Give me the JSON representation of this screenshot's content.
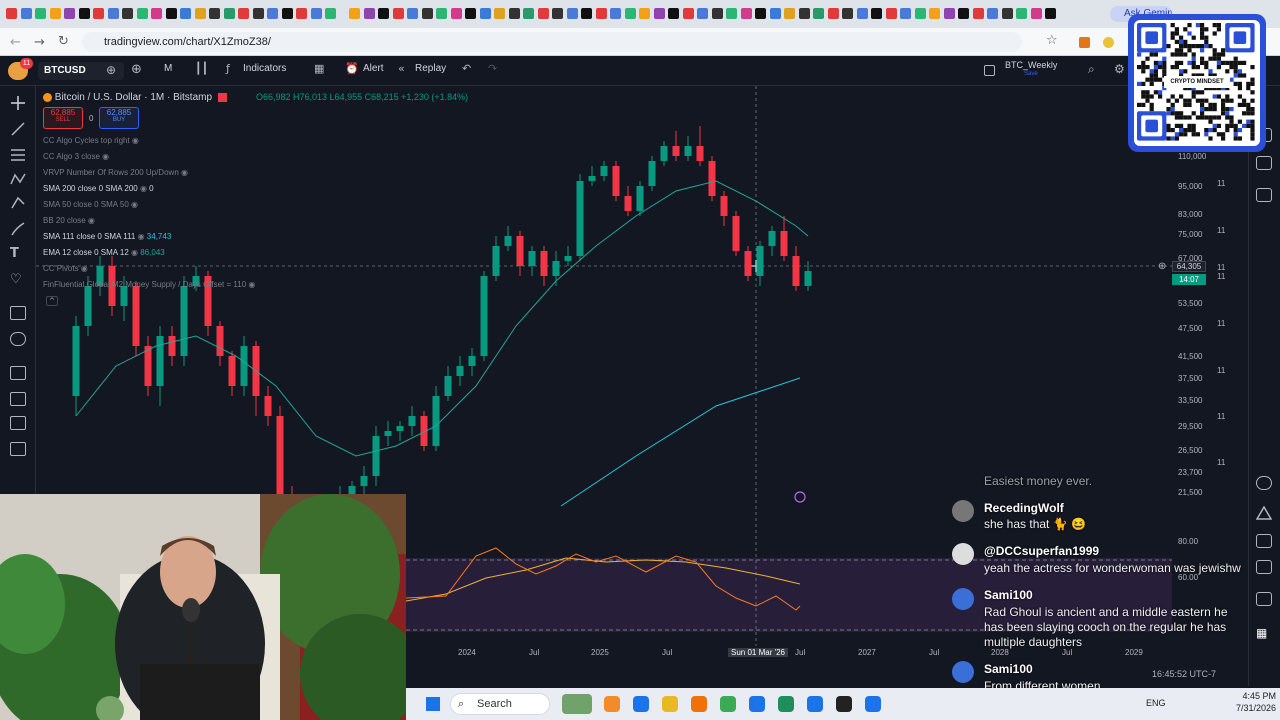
{
  "browser": {
    "url": "tradingview.com/chart/X1ZmoZ38/",
    "ask_label": "Ask Gemini"
  },
  "toolbar": {
    "symbol": "BTCUSD",
    "interval": "M",
    "indicators": "Indicators",
    "alert": "Alert",
    "replay": "Replay",
    "layout_name": "BTC_Weekly",
    "layout_sub": "Save",
    "badge": "11"
  },
  "legend": {
    "title": "Bitcoin / U.S. Dollar · 1M · Bitstamp",
    "ohlc": "O66,982 H76,013 L64,955 C68,215 +1,230 (+1.84%)",
    "sell_price": "62,885",
    "sell_label": "SELL",
    "spread": "0",
    "buy_price": "62,885",
    "buy_label": "BUY",
    "indicators": [
      {
        "text": "CC Algo Cycles top right",
        "value": ""
      },
      {
        "text": "CC Algo 3 close",
        "value": ""
      },
      {
        "text": "VRVP Number Of Rows 200 Up/Down",
        "value": ""
      },
      {
        "text": "SMA 200 close 0 SMA 200",
        "value": "0"
      },
      {
        "text": "SMA 50 close 0 SMA 50",
        "value": ""
      },
      {
        "text": "BB 20 close",
        "value": ""
      },
      {
        "text": "SMA 111 close 0 SMA 111",
        "value": "34,743"
      },
      {
        "text": "EMA 12 close 0 SMA 12",
        "value": "86,043"
      },
      {
        "text": "CC Pivots",
        "value": ""
      },
      {
        "text": "FinFluential Global M2 Money Supply / Days Offset = 110",
        "value": ""
      }
    ]
  },
  "price_axis": [
    "110,000",
    "95,000",
    "83,000",
    "75,000",
    "67,000",
    "53,500",
    "47,500",
    "41,500",
    "37,500",
    "33,500",
    "29,500",
    "26,500",
    "23,700",
    "21,500"
  ],
  "price_tag": {
    "value": "64,305",
    "time": "14:07"
  },
  "osc_axis": [
    "80.00",
    "60.00"
  ],
  "time_axis": [
    "2024",
    "Jul",
    "2025",
    "Jul",
    "Sun 01 Mar '26",
    "Jul",
    "2027",
    "Jul",
    "2028",
    "Jul",
    "2029"
  ],
  "qr_label": "CRYPTO MINDSET",
  "chat": [
    {
      "name": "",
      "msg": "Easiest money ever.",
      "color": "#888888"
    },
    {
      "name": "RecedingWolf",
      "msg": "she has that 🐈 😆",
      "color": "#9a9a9a"
    },
    {
      "name": "@DCCsuperfan1999",
      "msg": "yeah the actress for wonderwoman was jewishw",
      "color": "#dddddd"
    },
    {
      "name": "Sami100",
      "msg": "Rad Ghoul is ancient and a middle eastern he has been slaying cooch on the regular he has multiple daughters",
      "color": "#3a6fd8"
    },
    {
      "name": "Sami100",
      "msg": "From different women",
      "color": "#3a6fd8"
    }
  ],
  "taskbar": {
    "search": "Search",
    "lang": "ENG",
    "time": "4:45 PM",
    "date": "7/31/2026",
    "chart_time": "16:45:52 UTC-7"
  },
  "chart_data": {
    "type": "candlestick",
    "symbol": "BTCUSD",
    "interval": "1M",
    "last_close": 68215
  }
}
